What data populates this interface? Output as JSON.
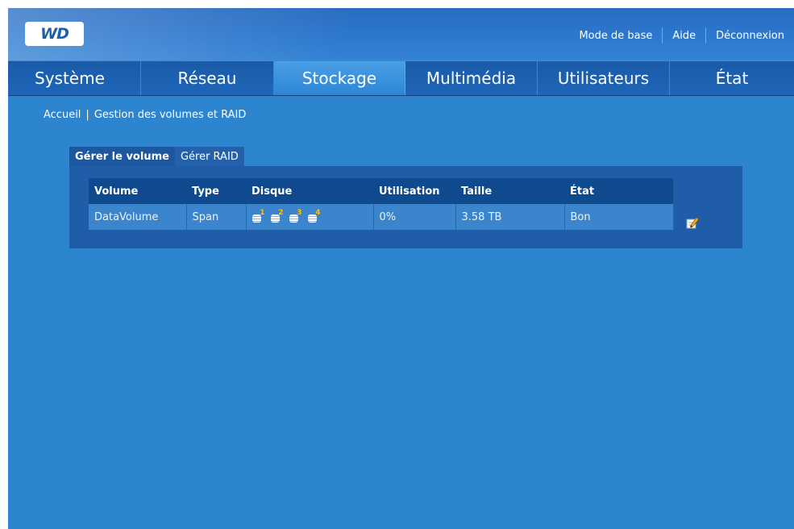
{
  "header": {
    "logo_text": "WD",
    "links": [
      "Mode de base",
      "Aide",
      "Déconnexion"
    ]
  },
  "nav": {
    "tabs": [
      "Système",
      "Réseau",
      "Stockage",
      "Multimédia",
      "Utilisateurs",
      "État"
    ],
    "active": "Stockage"
  },
  "breadcrumb": {
    "home": "Accueil",
    "separator": "|",
    "current": "Gestion des volumes et RAID"
  },
  "subtabs": {
    "manage_volume": "Gérer le volume",
    "manage_raid": "Gérer RAID"
  },
  "volumes_table": {
    "columns": [
      "Volume",
      "Type",
      "Disque",
      "Utilisation",
      "Taille",
      "État"
    ],
    "rows": [
      {
        "volume": "DataVolume",
        "type": "Span",
        "disks": [
          "1",
          "2",
          "3",
          "4"
        ],
        "usage": "0%",
        "size": "3.58 TB",
        "status": "Bon"
      }
    ]
  },
  "icons": {
    "disk": "disk-stack-icon",
    "edit": "edit-pencil-icon"
  },
  "colors": {
    "background": "#2d84cf",
    "tab_bar": "#1f66b8",
    "active_tab": "#3d94dd",
    "table_header": "#0f4a8e",
    "table_row": "#3b85cc",
    "panel": "#1f5da8",
    "disk_number": "#ffcc00"
  }
}
